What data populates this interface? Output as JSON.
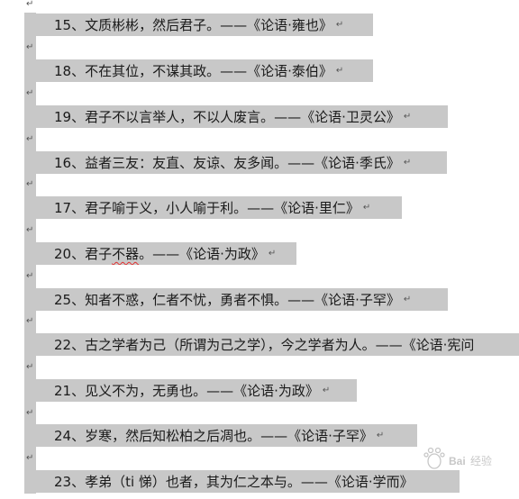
{
  "lines": [
    {
      "text": "15、文质彬彬，然后君子。——《论语·雍也》"
    },
    {
      "text": "18、不在其位，不谋其政。——《论语·泰伯》"
    },
    {
      "text": "19、君子不以言举人，不以人废言。——《论语·卫灵公》"
    },
    {
      "text": "16、益者三友：友直、友谅、友多闻。——《论语·季氏》"
    },
    {
      "text": "17、君子喻于义，小人喻于利。——《论语·里仁》"
    },
    {
      "pre": "20、君子",
      "squiggle": "不器",
      "post": "。——《论语·为政》"
    },
    {
      "text": "25、知者不惑，仁者不忧，勇者不惧。——《论语·子罕》"
    },
    {
      "text": "22、古之学者为己（所谓为己之学），今之学者为人。——《论语·宪问"
    },
    {
      "text": "21、见义不为，无勇也。——《论语·为政》"
    },
    {
      "text": "24、岁寒，然后知松柏之后凋也。——《论语·子罕》"
    },
    {
      "text": "23、孝弟（ti 悌）也者，其为仁之本与。——《论语·学而》"
    }
  ],
  "paragraph_mark": "↵",
  "watermark": "Baidu经验"
}
